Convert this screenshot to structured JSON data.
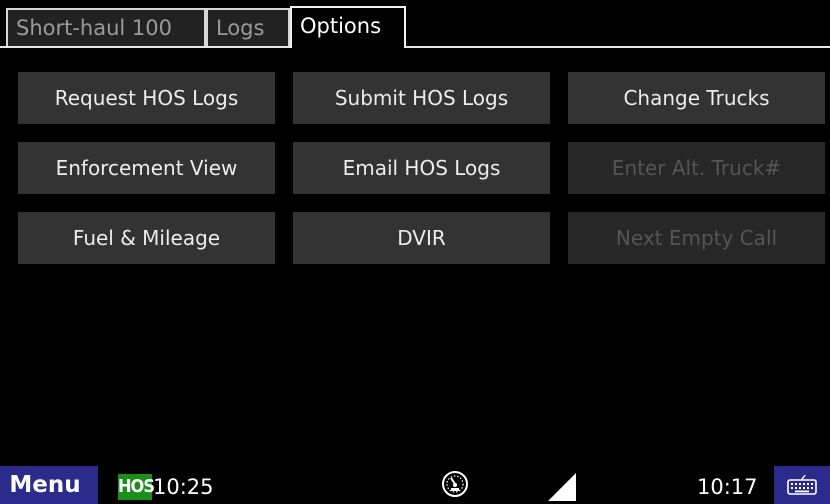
{
  "tabs": [
    {
      "label": "Short-haul 100",
      "active": false
    },
    {
      "label": "Logs",
      "active": false
    },
    {
      "label": "Options",
      "active": true
    }
  ],
  "buttons": [
    {
      "label": "Request HOS Logs",
      "enabled": true
    },
    {
      "label": "Submit HOS Logs",
      "enabled": true
    },
    {
      "label": "Change Trucks",
      "enabled": true
    },
    {
      "label": "Enforcement View",
      "enabled": true
    },
    {
      "label": "Email HOS Logs",
      "enabled": true
    },
    {
      "label": "Enter Alt. Truck#",
      "enabled": false
    },
    {
      "label": "Fuel & Mileage",
      "enabled": true
    },
    {
      "label": "DVIR",
      "enabled": true
    },
    {
      "label": "Next Empty Call",
      "enabled": false
    }
  ],
  "taskbar": {
    "menu_label": "Menu",
    "hos_badge": "HOS",
    "hos_time": "10:25",
    "clock": "10:17",
    "icons": [
      "gauge-icon",
      "signal-icon",
      "keyboard-icon"
    ]
  },
  "colors": {
    "menu_bg": "#2b2b8c",
    "hos_badge_bg": "#1a8f1a",
    "button_bg": "#333333",
    "button_disabled_text": "#555555"
  }
}
